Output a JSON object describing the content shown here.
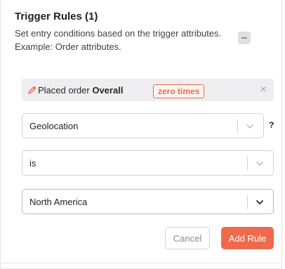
{
  "panel": {
    "title": "Trigger Rules (1)",
    "description": "Set entry conditions based on the trigger attributes. Example: Order attributes."
  },
  "rule": {
    "prefix": "Placed order",
    "scope": "Overall",
    "badge": "zero times",
    "icon": "pencil-icon",
    "close_icon": "close-icon"
  },
  "selects": {
    "attribute": {
      "value": "Geolocation",
      "help": "?"
    },
    "operator": {
      "value": "is"
    },
    "value": {
      "value": "North America"
    }
  },
  "actions": {
    "cancel_label": "Cancel",
    "add_label": "Add Rule"
  },
  "colors": {
    "accent": "#ef6a4c",
    "card_bg": "#eeeef1",
    "border": "#d4d4d8"
  }
}
